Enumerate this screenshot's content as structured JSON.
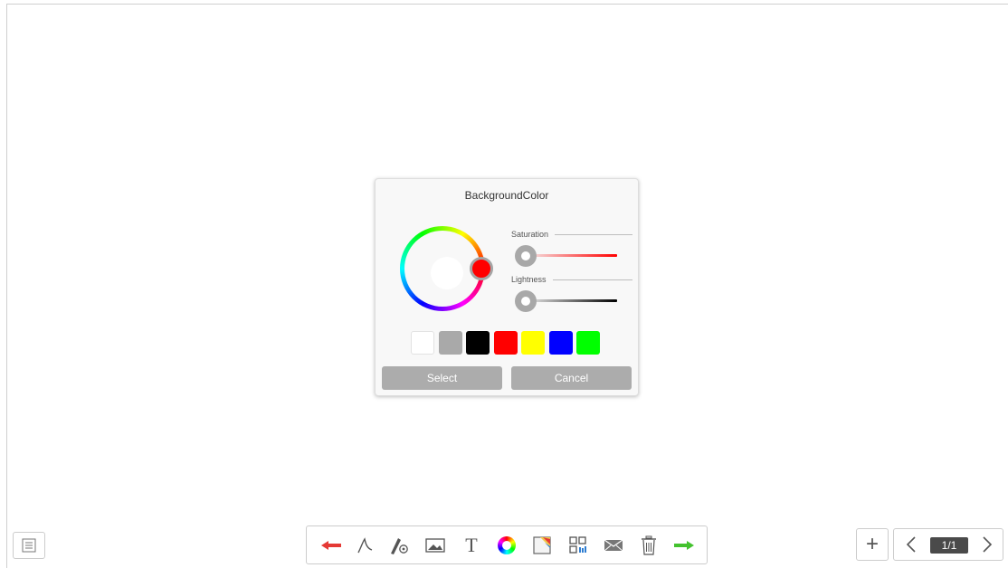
{
  "dialog": {
    "title": "BackgroundColor",
    "saturation_label": "Saturation",
    "lightness_label": "Lightness",
    "saturation_value": 0,
    "lightness_value": 0,
    "selected_hue_color": "#ff0000",
    "swatches": [
      {
        "name": "white",
        "color": "#ffffff"
      },
      {
        "name": "gray",
        "color": "#a9a9a9"
      },
      {
        "name": "black",
        "color": "#000000"
      },
      {
        "name": "red",
        "color": "#ff0000"
      },
      {
        "name": "yellow",
        "color": "#ffff00"
      },
      {
        "name": "blue",
        "color": "#0000ff"
      },
      {
        "name": "green",
        "color": "#00ff00"
      }
    ],
    "select_label": "Select",
    "cancel_label": "Cancel"
  },
  "toolbar": {
    "tools": [
      "undo-arrow-icon",
      "pen-icon",
      "pen-settings-icon",
      "image-icon",
      "text-icon",
      "color-wheel-icon",
      "background-icon",
      "qr-code-icon",
      "mail-icon",
      "trash-icon",
      "redo-arrow-icon"
    ],
    "text_tool_glyph": "T",
    "undo_color": "#e53935",
    "redo_color": "#43c22e"
  },
  "pager": {
    "add_glyph": "+",
    "page_indicator": "1/1"
  }
}
